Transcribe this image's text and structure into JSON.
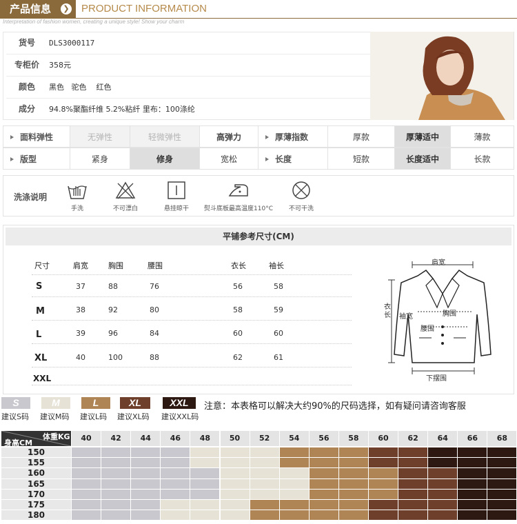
{
  "header": {
    "tag": "产品信息",
    "title": "PRODUCT INFORMATION",
    "subtitle": "Interpretation of fashion women, creating a unique style! Show your charm"
  },
  "info": [
    {
      "label": "货号",
      "value": "DLS3000117"
    },
    {
      "label": "专柜价",
      "value": "358元"
    },
    {
      "label": "颜色",
      "value": "黑色   驼色    红色"
    },
    {
      "label": "成分",
      "value": "94.8%聚酯纤维 5.2%粘纤  里布：100涤纶"
    }
  ],
  "attributes": {
    "rows": [
      {
        "left": {
          "label": "面料弹性",
          "options": [
            "无弹性",
            "轻微弹性",
            "高弹力"
          ],
          "selected": 2
        },
        "right": {
          "label": "厚薄指数",
          "options": [
            "厚款",
            "厚薄适中",
            "薄款"
          ],
          "selected": 1
        }
      },
      {
        "left": {
          "label": "版型",
          "options": [
            "紧身",
            "修身",
            "宽松"
          ],
          "selected": 1
        },
        "right": {
          "label": "长度",
          "options": [
            "短款",
            "长度适中",
            "长款"
          ],
          "selected": 1
        }
      }
    ]
  },
  "washing": {
    "label": "洗涤说明",
    "items": [
      {
        "icon": "hand-wash-icon",
        "caption": "手洗"
      },
      {
        "icon": "no-bleach-icon",
        "caption": "不可漂白"
      },
      {
        "icon": "hang-dry-icon",
        "caption": "悬挂晾干"
      },
      {
        "icon": "iron-icon",
        "caption": "熨斗底板最高温度110°C"
      },
      {
        "icon": "no-dry-clean-icon",
        "caption": "不可干洗"
      }
    ]
  },
  "size_table": {
    "title": "平铺参考尺寸(CM)",
    "headers": [
      "尺寸",
      "肩宽",
      "胸围",
      "腰围",
      "衣长",
      "袖长"
    ],
    "rows": [
      [
        "S",
        "37",
        "88",
        "76",
        "56",
        "58"
      ],
      [
        "M",
        "38",
        "92",
        "80",
        "58",
        "59"
      ],
      [
        "L",
        "39",
        "96",
        "84",
        "60",
        "60"
      ],
      [
        "XL",
        "40",
        "100",
        "88",
        "62",
        "61"
      ],
      [
        "XXL",
        "",
        "",
        "",
        "",
        ""
      ]
    ],
    "diagram_labels": {
      "shoulder": "肩宽",
      "length": "衣长",
      "sleeve": "袖宽",
      "chest": "胸围",
      "waist": "腰围",
      "hem": "下摆围"
    }
  },
  "legend": {
    "items": [
      {
        "size": "S",
        "caption": "建议S码",
        "color": "#c8c8ce"
      },
      {
        "size": "M",
        "caption": "建议M码",
        "color": "#e6e2d6"
      },
      {
        "size": "L",
        "caption": "建议L码",
        "color": "#b08556"
      },
      {
        "size": "XL",
        "caption": "建议XL码",
        "color": "#6e3f2b"
      },
      {
        "size": "XXL",
        "caption": "建议XXL码",
        "color": "#2e1812"
      }
    ],
    "note": "注意：本表格可以解决大约90%的尺码选择，如有疑问请咨询客服"
  },
  "chart_data": {
    "type": "table",
    "corner_height": "身高CM",
    "corner_weight": "体重KG",
    "weights": [
      "40",
      "42",
      "44",
      "46",
      "48",
      "50",
      "52",
      "54",
      "56",
      "58",
      "60",
      "62",
      "64",
      "66",
      "68"
    ],
    "heights": [
      "150",
      "155",
      "160",
      "165",
      "170",
      "175",
      "180"
    ],
    "grid": [
      [
        "S",
        "S",
        "S",
        "S",
        "M",
        "M",
        "M",
        "L",
        "L",
        "L",
        "XL",
        "XL",
        "XXL",
        "XXL",
        "XXL"
      ],
      [
        "S",
        "S",
        "S",
        "S",
        "M",
        "M",
        "M",
        "L",
        "L",
        "L",
        "XL",
        "XL",
        "XXL",
        "XXL",
        "XXL"
      ],
      [
        "S",
        "S",
        "S",
        "S",
        "S",
        "M",
        "M",
        "M",
        "L",
        "L",
        "L",
        "XL",
        "XL",
        "XXL",
        "XXL"
      ],
      [
        "S",
        "S",
        "S",
        "S",
        "S",
        "M",
        "M",
        "M",
        "L",
        "L",
        "L",
        "XL",
        "XL",
        "XXL",
        "XXL"
      ],
      [
        "S",
        "S",
        "S",
        "S",
        "S",
        "M",
        "M",
        "M",
        "L",
        "L",
        "L",
        "XL",
        "XL",
        "XXL",
        "XXL"
      ],
      [
        "S",
        "S",
        "S",
        "M",
        "M",
        "M",
        "L",
        "L",
        "L",
        "L",
        "XL",
        "XL",
        "XL",
        "XXL",
        "XXL"
      ],
      [
        "S",
        "S",
        "S",
        "M",
        "M",
        "M",
        "L",
        "L",
        "L",
        "L",
        "XL",
        "XL",
        "XL",
        "XXL",
        "XXL"
      ]
    ]
  }
}
